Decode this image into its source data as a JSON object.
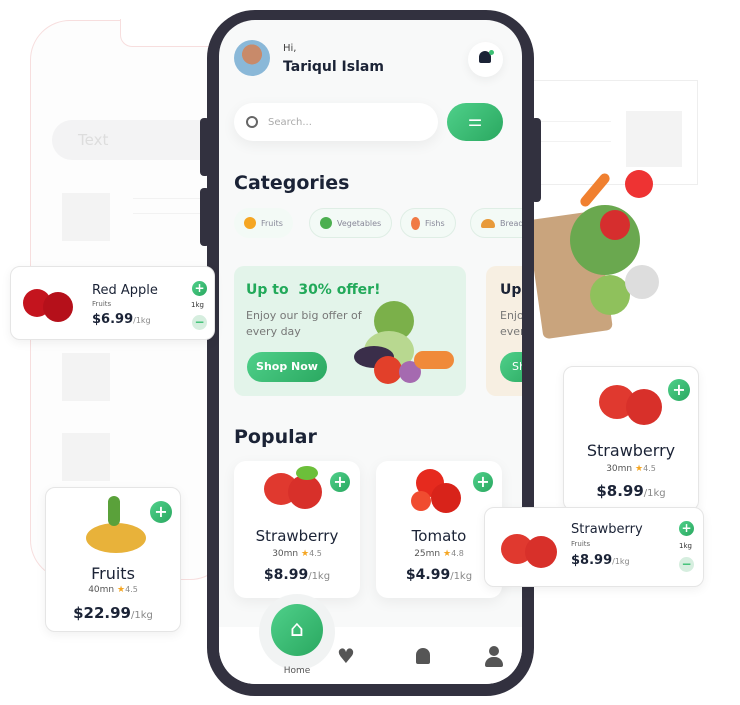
{
  "background": {
    "wire_text": "Text"
  },
  "header": {
    "greeting": "Hi,",
    "user_name": "Tariqul Islam"
  },
  "search": {
    "placeholder": "Search..."
  },
  "categories": {
    "title": "Categories",
    "items": [
      {
        "label": "Fruits",
        "active": true
      },
      {
        "label": "Vegetables"
      },
      {
        "label": "Fishs"
      },
      {
        "label": "Bread"
      }
    ]
  },
  "offer": {
    "title": "Up to  30% offer!",
    "subtitle": "Enjoy our big offer of every day",
    "button": "Shop Now",
    "second_title": "Up",
    "second_subtitle": "Enjo ever",
    "second_button": "Sh"
  },
  "popular": {
    "title": "Popular",
    "items": [
      {
        "name": "Strawberry",
        "time": "30mn",
        "rating": "4.5",
        "price": "$8.99",
        "unit": "/1kg"
      },
      {
        "name": "Tomato",
        "time": "25mn",
        "rating": "4.8",
        "price": "$4.99",
        "unit": "/1kg"
      }
    ]
  },
  "nav": {
    "home": "Home"
  },
  "floating": {
    "red_apple": {
      "name": "Red Apple",
      "category": "Fruits",
      "price": "$6.99",
      "unit": "/1kg",
      "qty": "1kg"
    },
    "fruits": {
      "name": "Fruits",
      "time": "40mn",
      "rating": "4.5",
      "price": "$22.99",
      "unit": "/1kg"
    },
    "strawberry_big": {
      "name": "Strawberry",
      "time": "30mn",
      "rating": "4.5",
      "price": "$8.99",
      "unit": "/1kg"
    },
    "strawberry_small": {
      "name": "Strawberry",
      "category": "Fruits",
      "price": "$8.99",
      "unit": "/1kg",
      "qty": "1kg"
    }
  },
  "colors": {
    "accent": "#3cc073",
    "frame": "#32313f",
    "text": "#1b2336",
    "offer_bg": "#e3f4ea",
    "star": "#f5a623"
  }
}
